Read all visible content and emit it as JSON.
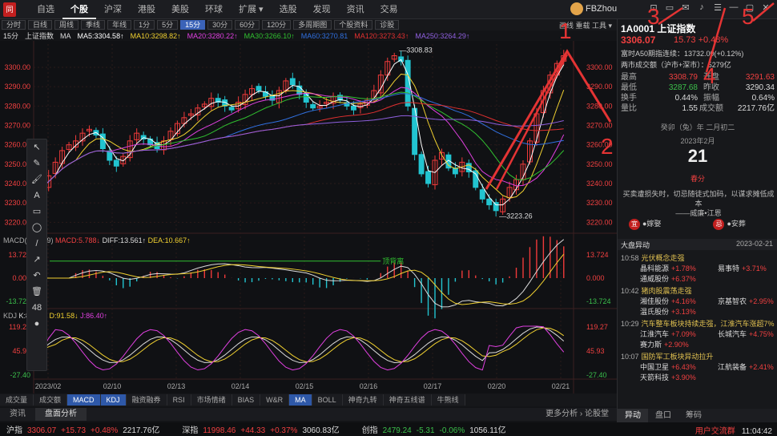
{
  "app": {
    "logo": "同花"
  },
  "nav": [
    "自选",
    "个股",
    "沪深",
    "港股",
    "美股",
    "环球",
    "扩展 ▾",
    "选股",
    "发现",
    "资讯",
    "交易"
  ],
  "nav_active": 1,
  "user": "FBZhou",
  "window_icons": [
    "⊡",
    "▭",
    "✉",
    "♪",
    "☰",
    "—",
    "▢",
    "✕"
  ],
  "toolbar": {
    "items": [
      "分时",
      "日线",
      "周线",
      "季线",
      "年线",
      "1分",
      "5分",
      "15分",
      "30分",
      "60分",
      "120分",
      "多周期图",
      "个股资料",
      "诊股"
    ],
    "active": "15分",
    "right": "画线  重载  工具 ▾"
  },
  "ma_legend": {
    "period": "15分",
    "index": "上证指数",
    "ma": "MA",
    "ma5": "MA5:3304.58↑",
    "ma10": "MA10:3298.82↑",
    "ma20": "MA20:3280.22↑",
    "ma30": "MA30:3266.10↑",
    "ma60": "MA60:3270.81",
    "ma120": "MA120:3273.43↑",
    "ma250": "MA250:3264.29↑"
  },
  "macd_legend": {
    "name": "MACD(12,26,9)",
    "macd": "MACD:5.788↓",
    "diff": "DIFF:13.561↑",
    "dea": "DEA:10.667↑"
  },
  "kdj_legend": {
    "name": "KDJ",
    "k": "K:89.85↓",
    "d": "D:91.58↓",
    "j": "J:86.40↑"
  },
  "chart_data": [
    {
      "type": "candlestick",
      "title": "上证指数 15分",
      "yticks": [
        "3300.00",
        "3290.00",
        "3280.00",
        "3270.00",
        "3260.00",
        "3250.00",
        "3240.00",
        "3230.00",
        "3220.00"
      ],
      "ylim": [
        3216,
        3312
      ],
      "xticks": [
        "2023/02",
        "02/10",
        "02/13",
        "02/14",
        "02/15",
        "02/16",
        "02/17",
        "02/20",
        "02/21"
      ],
      "annotations": [
        "3308.83",
        "3223.26"
      ],
      "closes": [
        3238,
        3244,
        3251,
        3257,
        3260,
        3262,
        3266,
        3268,
        3265,
        3258,
        3252,
        3249,
        3254,
        3262,
        3266,
        3263,
        3260,
        3258,
        3262,
        3267,
        3271,
        3274,
        3276,
        3279,
        3281,
        3284,
        3282,
        3280,
        3278,
        3282,
        3286,
        3289,
        3288,
        3285,
        3283,
        3288,
        3293,
        3291,
        3286,
        3282,
        3279,
        3280,
        3282,
        3285,
        3283,
        3280,
        3278,
        3281,
        3283,
        3288,
        3296,
        3303,
        3306,
        3303,
        3280,
        3255,
        3245,
        3240,
        3252,
        3256,
        3248,
        3245,
        3251,
        3246,
        3238,
        3232,
        3229,
        3226,
        3232,
        3238,
        3242,
        3250,
        3262,
        3276,
        3288,
        3296,
        3302,
        3306
      ],
      "ma_names": [
        "MA5",
        "MA10",
        "MA20",
        "MA30",
        "MA60",
        "MA120",
        "MA250"
      ],
      "ma_colors": [
        "#ffffff",
        "#f0d030",
        "#e040e0",
        "#30c030",
        "#3070e0",
        "#e03030",
        "#9060e0"
      ]
    },
    {
      "type": "macd",
      "yticks": [
        "13.724",
        "0.000",
        "-13.724"
      ],
      "ylim": [
        -16,
        16
      ],
      "annotation": "顶背离"
    },
    {
      "type": "kdj",
      "yticks": [
        "119.27",
        "45.93",
        "-27.40"
      ],
      "ylim": [
        -30,
        122
      ]
    }
  ],
  "draw_tools": [
    "↖",
    "✎",
    "🖌",
    "A",
    "▭",
    "◯",
    "/",
    "↗",
    "↶",
    "🗑",
    "48",
    "●"
  ],
  "indicator_tabs": [
    "成交量",
    "成交额",
    "MACD",
    "KDJ",
    "融资融券",
    "RSI",
    "市场情绪",
    "BIAS",
    "W&R",
    "MA",
    "BOLL",
    "神奇九转",
    "神奇五线谱",
    "牛熊线"
  ],
  "indicator_active": [
    "MACD",
    "KDJ",
    "MA"
  ],
  "info_tabs": [
    "资讯",
    "盘面分析"
  ],
  "info_active": "盘面分析",
  "info_right": "更多分析 ›    论股堂",
  "status": [
    {
      "label": "沪指",
      "v1": "3306.07",
      "v2": "+15.73",
      "v3": "+0.48%",
      "v4": "2217.76亿"
    },
    {
      "label": "深指",
      "v1": "11998.46",
      "v2": "+44.33",
      "v3": "+0.37%",
      "v4": "3060.83亿"
    },
    {
      "label": "创指",
      "v1": "2479.24",
      "v2": "-5.31",
      "v3": "-0.06%",
      "v4": "1056.11亿"
    }
  ],
  "status_right": {
    "link": "用户交流群",
    "time": "11:04:42"
  },
  "quote": {
    "code": "1A0001",
    "name": "上证指数",
    "price": "3306.07",
    "chg": "15.73",
    "chgpct": "+0.48%",
    "futures": "富时A50期指连续：13732.00(+0.12%)",
    "turnover": "两市成交额（沪市+深市）：5279亿",
    "rows": [
      [
        "最高",
        "3308.79",
        "开盘",
        "3291.63"
      ],
      [
        "最低",
        "3287.68",
        "昨收",
        "3290.34"
      ],
      [
        "换手",
        "0.44%",
        "振幅",
        "0.64%"
      ],
      [
        "量比",
        "1.55",
        "成交额",
        "2217.76亿"
      ]
    ]
  },
  "calendar": {
    "head": "癸卯（兔）年  二月初二",
    "yearmonth": "2023年2月",
    "day": "21",
    "note": "春分",
    "quote": "买卖遭损失时，切忌随徒式加码，以谋求摊低成本",
    "author": "——威廉•江恩",
    "yi": "●嫁娶",
    "ji": "●安葬"
  },
  "market_moves": {
    "title": "大盘异动",
    "date": "2023-02-21",
    "alerts": [
      {
        "time": "10:58",
        "title": "光伏概念走强",
        "stocks": [
          [
            "晶科能源",
            "+1.78%"
          ],
          [
            "易事特",
            "+3.71%"
          ],
          [
            "通威股份",
            "+6.37%"
          ]
        ]
      },
      {
        "time": "10:42",
        "title": "猪肉股震荡走强",
        "stocks": [
          [
            "湘佳股份",
            "+4.16%"
          ],
          [
            "京基智农",
            "+2.95%"
          ],
          [
            "温氏股份",
            "+3.13%"
          ]
        ]
      },
      {
        "time": "10:29",
        "title": "汽车整车板块持续走强，江淮汽车涨超7%",
        "stocks": [
          [
            "江淮汽车",
            "+7.09%"
          ],
          [
            "长城汽车",
            "+4.75%"
          ],
          [
            "赛力斯",
            "+2.90%"
          ]
        ]
      },
      {
        "time": "10:07",
        "title": "国防军工板块异动拉升",
        "stocks": [
          [
            "中国卫星",
            "+6.43%"
          ],
          [
            "江航装备",
            "+2.41%"
          ],
          [
            "天箭科技",
            "+3.90%"
          ]
        ]
      }
    ]
  },
  "right_tabs": [
    "异动",
    "盘口",
    "筹码"
  ],
  "right_tab_active": "异动",
  "annotation_numbers": [
    "1",
    "2",
    "3",
    "4",
    "5"
  ]
}
